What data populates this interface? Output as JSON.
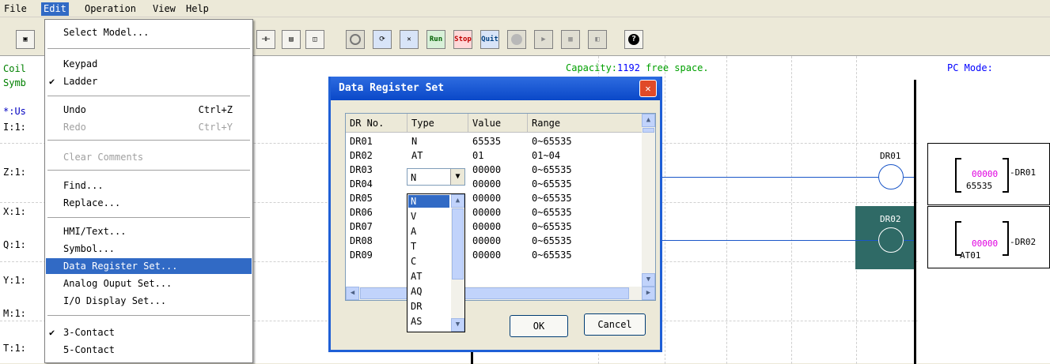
{
  "menubar": {
    "items": [
      {
        "label": "File"
      },
      {
        "label": "Edit"
      },
      {
        "label": "Operation"
      },
      {
        "label": "View"
      },
      {
        "label": "Help"
      }
    ]
  },
  "toolbar": {
    "run_label": "Run",
    "stop_label": "Stop",
    "quit_label": "Quit",
    "help_label": "?"
  },
  "canvas": {
    "capacity_prefix": "Capacity:",
    "capacity_value": "1192",
    "capacity_suffix": " free space.",
    "pc_mode": "PC Mode:",
    "left_labels": [
      "Coil",
      "Symb",
      "*:Us",
      "I:1:",
      "Z:1:",
      "X:1:",
      "Q:1:",
      "Y:1:",
      "M:1:",
      "T:1:"
    ],
    "coil1_label": "DR01",
    "coil2_label": "DR02",
    "box1_value": "00000",
    "box1_sub": "65535",
    "box1_name": "DR01",
    "box2_value": "00000",
    "box2_sub": "AT01",
    "box2_name": "DR02"
  },
  "edit_menu": {
    "select_model": "Select Model...",
    "keypad": "Keypad",
    "ladder": "Ladder",
    "undo": "Undo",
    "undo_sc": "Ctrl+Z",
    "redo": "Redo",
    "redo_sc": "Ctrl+Y",
    "clear_comments": "Clear Comments",
    "find": "Find...",
    "replace": "Replace...",
    "hmi_text": "HMI/Text...",
    "symbol": "Symbol...",
    "data_register_set": "Data Register Set...",
    "analog_ouput_set": "Analog Ouput Set...",
    "io_display_set": "I/O Display Set...",
    "three_contact": "3-Contact",
    "five_contact": "5-Contact",
    "check": "✔"
  },
  "dialog": {
    "title": "Data Register Set",
    "close": "✕",
    "headers": [
      "DR No.",
      "Type",
      "Value",
      "Range"
    ],
    "rows": [
      {
        "no": "DR01",
        "type": "N",
        "value": "65535",
        "range": "0~65535"
      },
      {
        "no": "DR02",
        "type": "AT",
        "value": "01",
        "range": "01~04"
      },
      {
        "no": "DR03",
        "type": "",
        "value": "00000",
        "range": "0~65535"
      },
      {
        "no": "DR04",
        "type": "",
        "value": "00000",
        "range": "0~65535"
      },
      {
        "no": "DR05",
        "type": "",
        "value": "00000",
        "range": "0~65535"
      },
      {
        "no": "DR06",
        "type": "",
        "value": "00000",
        "range": "0~65535"
      },
      {
        "no": "DR07",
        "type": "",
        "value": "00000",
        "range": "0~65535"
      },
      {
        "no": "DR08",
        "type": "",
        "value": "00000",
        "range": "0~65535"
      },
      {
        "no": "DR09",
        "type": "",
        "value": "00000",
        "range": "0~65535"
      }
    ],
    "combo_value": "N",
    "type_options": [
      "N",
      "V",
      "A",
      "T",
      "C",
      "AT",
      "AQ",
      "DR",
      "AS"
    ],
    "ok": "OK",
    "cancel": "Cancel"
  },
  "colors": {
    "accent": "#316ac5",
    "highlight_block": "#2f6a66",
    "value_magenta": "#e000e0",
    "capacity_blue": "#0000ff"
  }
}
